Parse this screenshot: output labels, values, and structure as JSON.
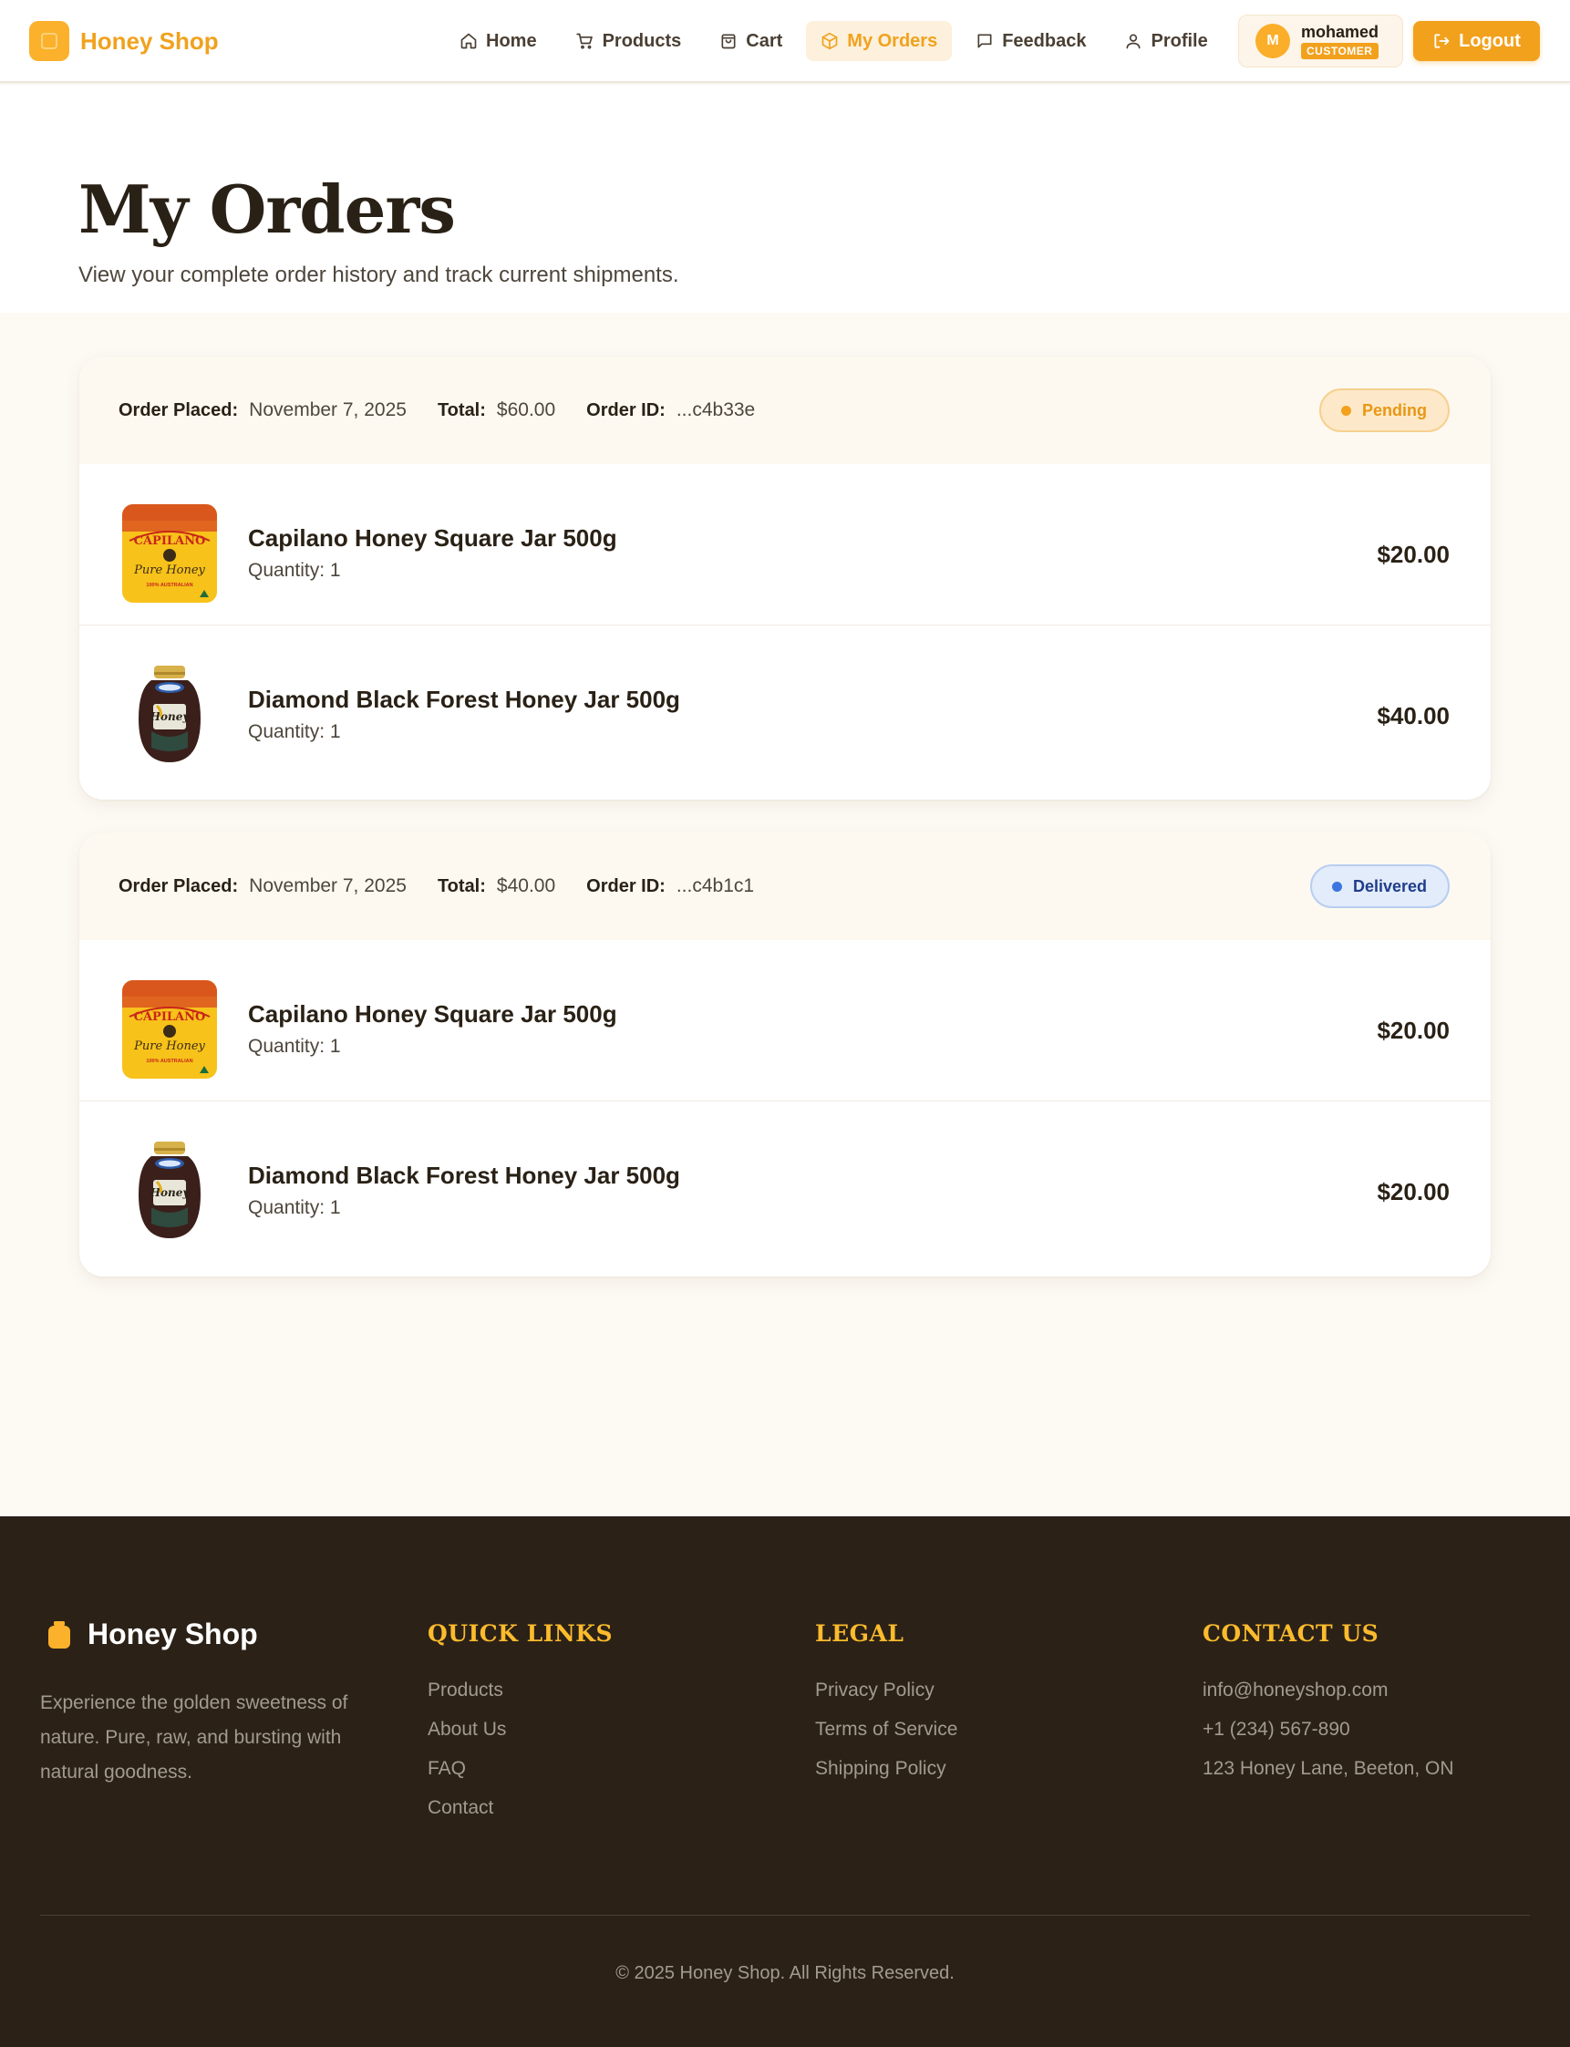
{
  "brand": {
    "name": "Honey Shop"
  },
  "nav": {
    "items": [
      {
        "label": "Home",
        "icon": "home-icon"
      },
      {
        "label": "Products",
        "icon": "cart-icon"
      },
      {
        "label": "Cart",
        "icon": "bag-icon"
      },
      {
        "label": "My Orders",
        "icon": "box-icon",
        "active": true
      },
      {
        "label": "Feedback",
        "icon": "chat-icon"
      },
      {
        "label": "Profile",
        "icon": "user-icon"
      }
    ]
  },
  "user": {
    "initial": "M",
    "name": "mohamed",
    "role": "CUSTOMER"
  },
  "logout_label": "Logout",
  "page": {
    "title": "My Orders",
    "subtitle": "View your complete order history and track current shipments."
  },
  "labels": {
    "placed": "Order Placed:",
    "total": "Total:",
    "id": "Order ID:"
  },
  "orders": [
    {
      "placed": "November 7, 2025",
      "total": "$60.00",
      "id": "...c4b33e",
      "status": "Pending",
      "items": [
        {
          "name": "Capilano Honey Square Jar 500g",
          "quantity": "Quantity: 1",
          "price": "$20.00",
          "image": "capilano-jar"
        },
        {
          "name": "Diamond Black Forest Honey Jar 500g",
          "quantity": "Quantity: 1",
          "price": "$40.00",
          "image": "black-forest-jar"
        }
      ]
    },
    {
      "placed": "November 7, 2025",
      "total": "$40.00",
      "id": "...c4b1c1",
      "status": "Delivered",
      "items": [
        {
          "name": "Capilano Honey Square Jar 500g",
          "quantity": "Quantity: 1",
          "price": "$20.00",
          "image": "capilano-jar"
        },
        {
          "name": "Diamond Black Forest Honey Jar 500g",
          "quantity": "Quantity: 1",
          "price": "$20.00",
          "image": "black-forest-jar"
        }
      ]
    }
  ],
  "product_labels": {
    "capilano": {
      "brand": "CAPILANO",
      "name": "Pure Honey",
      "tag": "100% AUSTRALIAN"
    },
    "diamond": {
      "word": "Honey"
    }
  },
  "footer": {
    "brand": "Honey Shop",
    "description": "Experience the golden sweetness of nature. Pure, raw, and bursting with natural goodness.",
    "quick_links": {
      "title": "QUICK LINKS",
      "items": [
        "Products",
        "About Us",
        "FAQ",
        "Contact"
      ]
    },
    "legal": {
      "title": "LEGAL",
      "items": [
        "Privacy Policy",
        "Terms of Service",
        "Shipping Policy"
      ]
    },
    "contact": {
      "title": "CONTACT US",
      "items": [
        "info@honeyshop.com",
        "+1 (234) 567-890",
        "123 Honey Lane, Beeton, ON"
      ]
    },
    "copyright": "© 2025 Honey Shop. All Rights Reserved."
  },
  "colors": {
    "accent": "#f2a11d",
    "pending": "#e89713",
    "delivered": "#1f3d8a",
    "footer_bg": "#2b2117"
  }
}
